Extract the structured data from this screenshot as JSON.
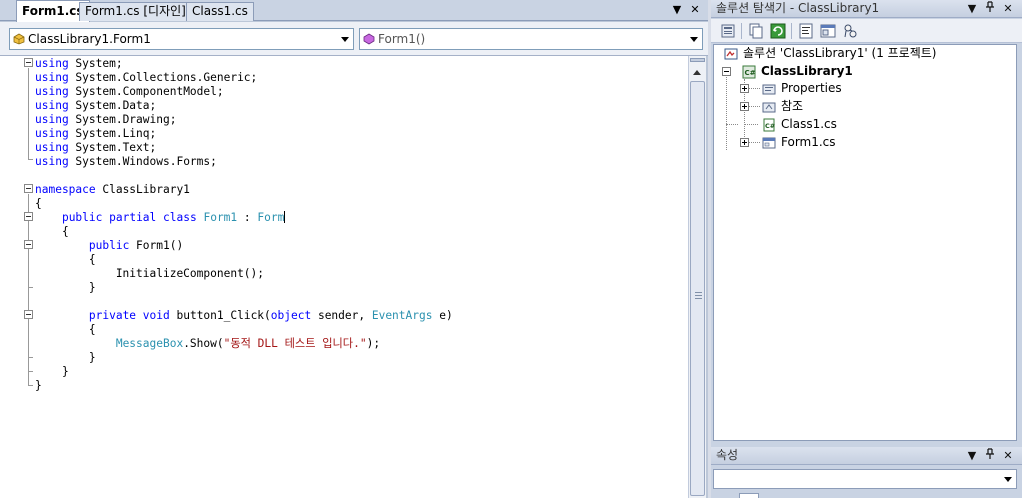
{
  "doc_tabs": [
    {
      "label": "Form1.cs",
      "active": true
    },
    {
      "label": "Form1.cs [디자인]",
      "active": false
    },
    {
      "label": "Class1.cs",
      "active": false
    }
  ],
  "tab_controls": {
    "dropdown": "▼",
    "close": "✕"
  },
  "nav": {
    "class_combo": "ClassLibrary1.Form1",
    "member_combo": "Form1()"
  },
  "code": {
    "lines": [
      [
        [
          "kw",
          "using"
        ],
        [
          "id",
          " System;"
        ]
      ],
      [
        [
          "kw",
          "using"
        ],
        [
          "id",
          " System.Collections.Generic;"
        ]
      ],
      [
        [
          "kw",
          "using"
        ],
        [
          "id",
          " System.ComponentModel;"
        ]
      ],
      [
        [
          "kw",
          "using"
        ],
        [
          "id",
          " System.Data;"
        ]
      ],
      [
        [
          "kw",
          "using"
        ],
        [
          "id",
          " System.Drawing;"
        ]
      ],
      [
        [
          "kw",
          "using"
        ],
        [
          "id",
          " System.Linq;"
        ]
      ],
      [
        [
          "kw",
          "using"
        ],
        [
          "id",
          " System.Text;"
        ]
      ],
      [
        [
          "kw",
          "using"
        ],
        [
          "id",
          " System.Windows.Forms;"
        ]
      ],
      [],
      [
        [
          "kw",
          "namespace"
        ],
        [
          "id",
          " ClassLibrary1"
        ]
      ],
      [
        [
          "id",
          "{"
        ]
      ],
      [
        [
          "id",
          "    "
        ],
        [
          "kw",
          "public"
        ],
        [
          "id",
          " "
        ],
        [
          "kw",
          "partial"
        ],
        [
          "id",
          " "
        ],
        [
          "kw",
          "class"
        ],
        [
          "id",
          " "
        ],
        [
          "ty",
          "Form1"
        ],
        [
          "id",
          " : "
        ],
        [
          "ty",
          "Form"
        ],
        [
          "caret",
          ""
        ]
      ],
      [
        [
          "id",
          "    {"
        ]
      ],
      [
        [
          "id",
          "        "
        ],
        [
          "kw",
          "public"
        ],
        [
          "id",
          " Form1()"
        ]
      ],
      [
        [
          "id",
          "        {"
        ]
      ],
      [
        [
          "id",
          "            InitializeComponent();"
        ]
      ],
      [
        [
          "id",
          "        }"
        ]
      ],
      [],
      [
        [
          "id",
          "        "
        ],
        [
          "kw",
          "private"
        ],
        [
          "id",
          " "
        ],
        [
          "kw",
          "void"
        ],
        [
          "id",
          " button1_Click("
        ],
        [
          "kw",
          "object"
        ],
        [
          "id",
          " sender, "
        ],
        [
          "ty",
          "EventArgs"
        ],
        [
          "id",
          " e)"
        ]
      ],
      [
        [
          "id",
          "        {"
        ]
      ],
      [
        [
          "id",
          "            "
        ],
        [
          "ty",
          "MessageBox"
        ],
        [
          "id",
          ".Show("
        ],
        [
          "st",
          "\"동적 DLL 테스트 입니다.\""
        ],
        [
          "id",
          ");"
        ]
      ],
      [
        [
          "id",
          "        }"
        ]
      ],
      [
        [
          "id",
          "    }"
        ]
      ],
      [
        [
          "id",
          "}"
        ]
      ]
    ]
  },
  "solution_explorer": {
    "title": "솔루션 탐색기 - ClassLibrary1",
    "controls": {
      "dropdown": "▼",
      "pin": "ᵖ",
      "close": "✕"
    },
    "tree": {
      "solution": "솔루션 'ClassLibrary1' (1 프로젝트)",
      "project": "ClassLibrary1",
      "items": [
        {
          "label": "Properties",
          "icon": "properties-folder-icon",
          "expandable": true
        },
        {
          "label": "참조",
          "icon": "references-folder-icon",
          "expandable": true
        },
        {
          "label": "Class1.cs",
          "icon": "csharp-file-icon",
          "expandable": false
        },
        {
          "label": "Form1.cs",
          "icon": "form-file-icon",
          "expandable": true
        }
      ]
    }
  },
  "properties_panel": {
    "title": "속성",
    "controls": {
      "dropdown": "▼",
      "pin": "ᵖ",
      "close": "✕"
    }
  }
}
